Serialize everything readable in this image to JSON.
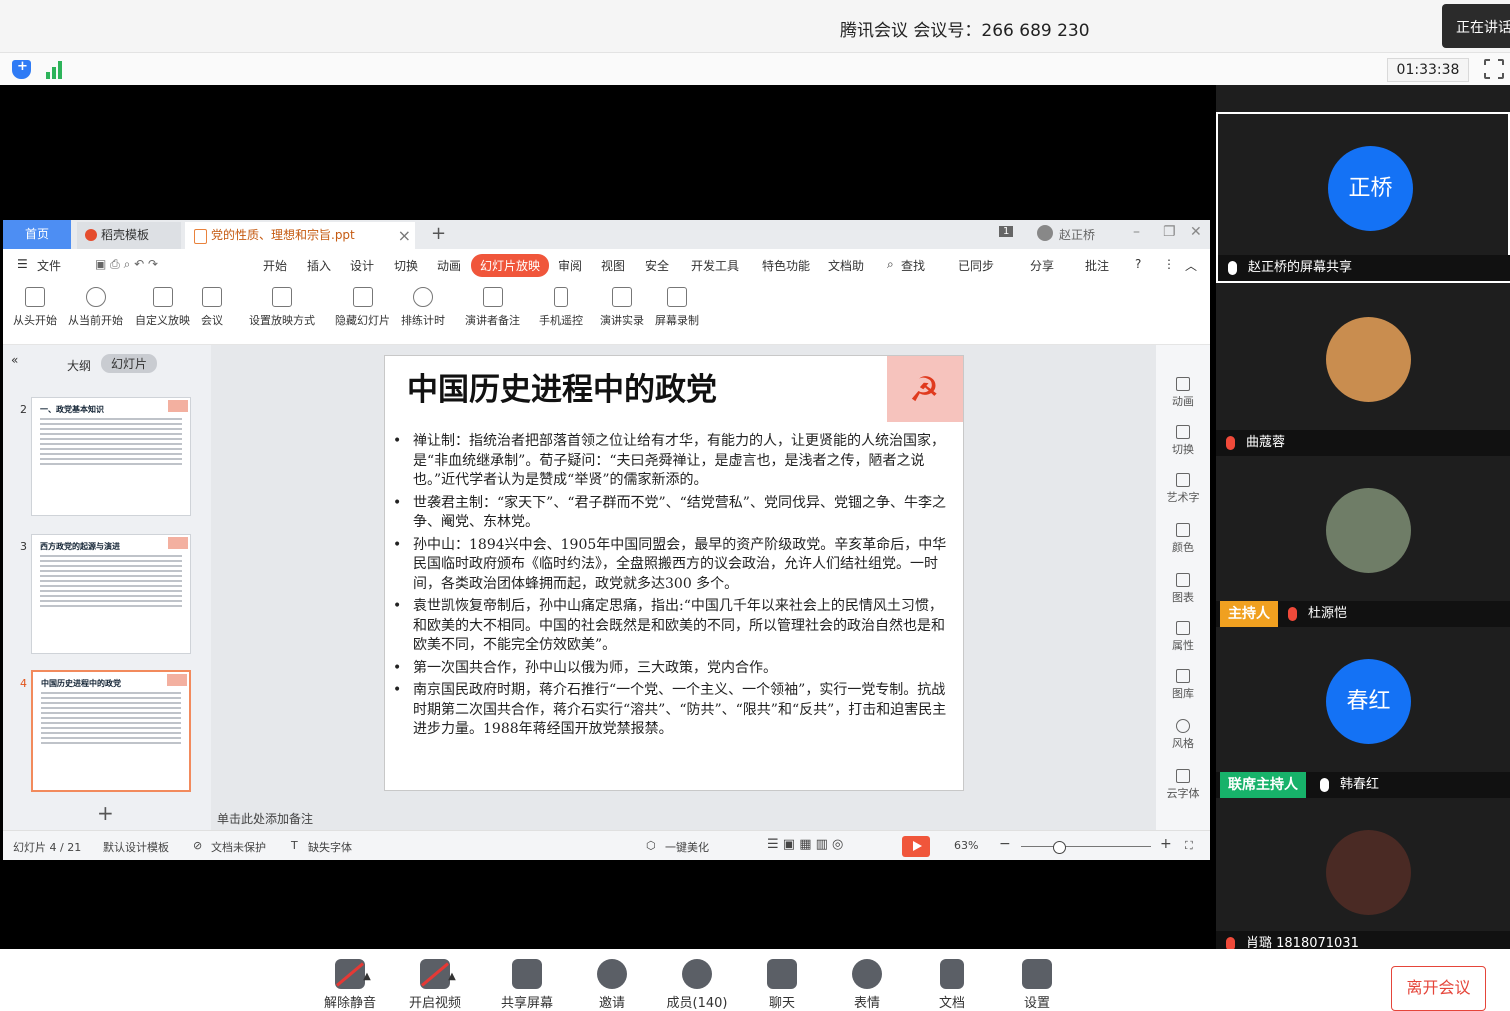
{
  "meeting": {
    "title": "腾讯会议 会议号：266 689 230",
    "speaking_label": "正在讲话",
    "timer": "01:33:38"
  },
  "wps": {
    "tabs": {
      "home": "首页",
      "template": "稻壳模板",
      "document": "党的性质、理想和宗旨.ppt"
    },
    "window_badge": "1",
    "user": "赵正桥",
    "menu": [
      "文件",
      "开始",
      "插入",
      "设计",
      "切换",
      "动画",
      "幻灯片放映",
      "审阅",
      "视图",
      "安全",
      "开发工具",
      "特色功能",
      "文档助"
    ],
    "menu_right": [
      "查找",
      "已同步",
      "分享",
      "批注"
    ],
    "ribbon": [
      "从头开始",
      "从当前开始",
      "自定义放映",
      "会议",
      "设置放映方式",
      "隐藏幻灯片",
      "排练计时",
      "演讲者备注",
      "手机遥控",
      "演讲实录",
      "屏幕录制"
    ],
    "pane_tabs": {
      "outline": "大纲",
      "slides": "幻灯片"
    },
    "thumbs": [
      {
        "num": "2",
        "title": "一、政党基本知识"
      },
      {
        "num": "3",
        "title": "西方政党的起源与演进"
      },
      {
        "num": "4",
        "title": "中国历史进程中的政党"
      }
    ],
    "add_slide": "+",
    "add_note": "单击此处添加备注",
    "rail": [
      "动画",
      "切换",
      "艺术字",
      "颜色",
      "图表",
      "属性",
      "图库",
      "风格",
      "云字体"
    ],
    "status": {
      "slide_count": "幻灯片 4 / 21",
      "template": "默认设计模板",
      "protect": "文档未保护",
      "font": "缺失字体",
      "beautify": "一键美化",
      "zoom": "63%"
    }
  },
  "slide": {
    "title": "中国历史进程中的政党",
    "bullets": [
      "禅让制：指统治者把部落首领之位让给有才华，有能力的人，让更贤能的人统治国家，是“非血统继承制”。荀子疑问：“夫曰尧舜禅让，是虚言也，是浅者之传，陋者之说也。”近代学者认为是赞成“举贤”的儒家新添的。",
      "世袭君主制：“家天下”、“君子群而不党”、“结党营私”、党同伐异、党锢之争、牛李之争、阉党、东林党。",
      "孙中山：1894兴中会、1905年中国同盟会，最早的资产阶级政党。辛亥革命后，中华民国临时政府颁布《临时约法》，全盘照搬西方的议会政治，允许人们结社组党。一时间，各类政治团体蜂拥而起，政党就多达300 多个。",
      "袁世凯恢复帝制后，孙中山痛定思痛，指出:“中国几千年以来社会上的民情风土习惯，和欧美的大不相同。中国的社会既然是和欧美的不同，所以管理社会的政治自然也是和欧美不同，不能完全仿效欧美”。",
      "第一次国共合作，孙中山以俄为师，三大政策，党内合作。",
      "南京国民政府时期，蒋介石推行“一个党、一个主义、一个领袖”，实行一党专制。抗战时期第二次国共合作，蒋介石实行“溶共”、“防共”、“限共”和“反共”，打击和迫害民主进步力量。1988年蒋经国开放党禁报禁。"
    ]
  },
  "participants": [
    {
      "avatar_text": "正桥",
      "name": "赵正桥的屏幕共享",
      "role": ""
    },
    {
      "avatar_text": "",
      "name": "曲蔻蓉",
      "role": ""
    },
    {
      "avatar_text": "",
      "name": "杜源恺",
      "role": "主持人"
    },
    {
      "avatar_text": "春红",
      "name": "韩春红",
      "role": "联席主持人"
    },
    {
      "avatar_text": "",
      "name": "肖璐 1818071031",
      "role": ""
    }
  ],
  "toolbar": [
    "解除静音",
    "开启视频",
    "共享屏幕",
    "邀请",
    "成员(140)",
    "聊天",
    "表情",
    "文档",
    "设置"
  ],
  "leave_label": "离开会议",
  "colors": {
    "accent": "#1472f5",
    "host": "#f0a020",
    "cohost": "#17b26a",
    "wps_accent": "#f0563b",
    "leave": "#e5453a"
  }
}
